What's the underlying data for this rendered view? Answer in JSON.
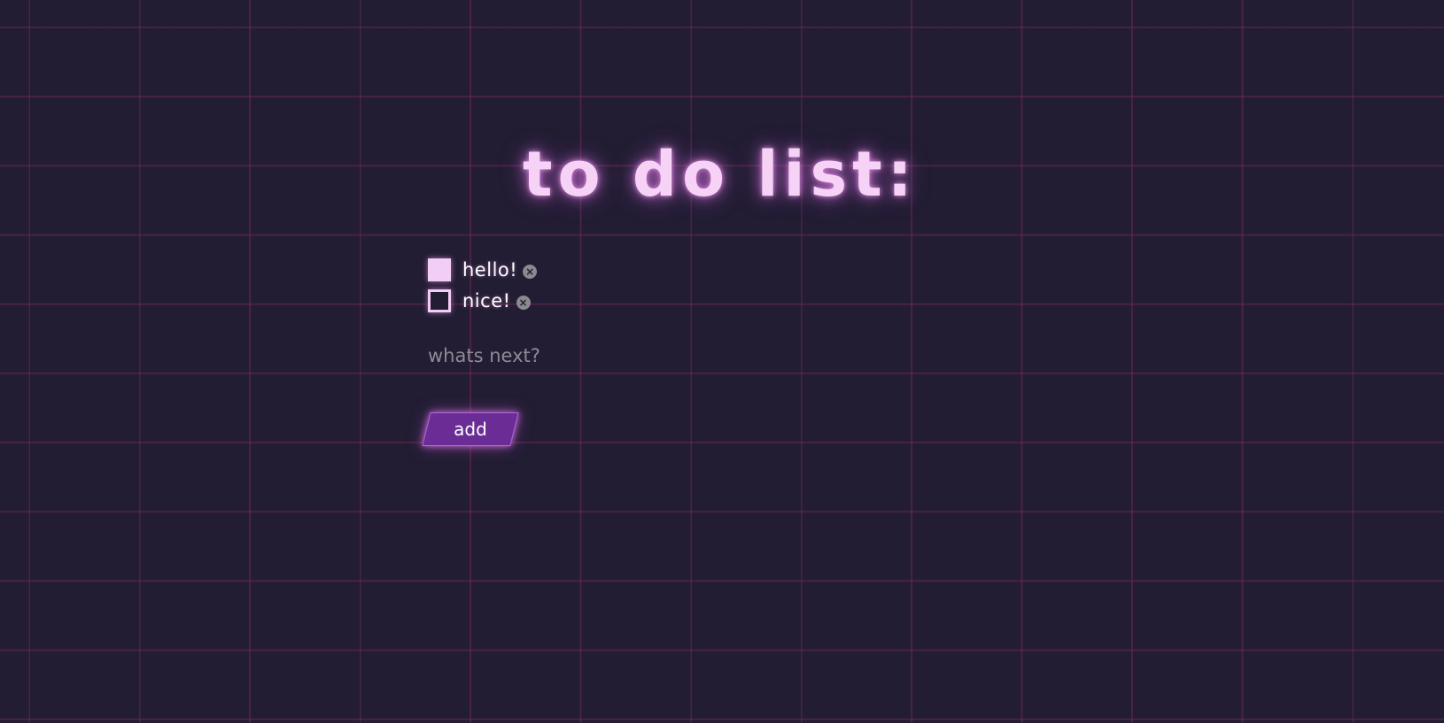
{
  "page": {
    "title": "to do list:"
  },
  "todos": [
    {
      "label": "hello!",
      "checked": true,
      "delete_icon": "close-circle-icon"
    },
    {
      "label": "nice!",
      "checked": false,
      "delete_icon": "close-circle-icon"
    }
  ],
  "new_item": {
    "value": "",
    "placeholder": "whats next?"
  },
  "add_button": {
    "label": "add"
  },
  "colors": {
    "background": "#221d33",
    "grid": "#4a2346",
    "title": "#f6d3f6",
    "checkbox": "#f2cdf4",
    "button": "#6a2d95",
    "placeholder": "#8d8a98"
  }
}
